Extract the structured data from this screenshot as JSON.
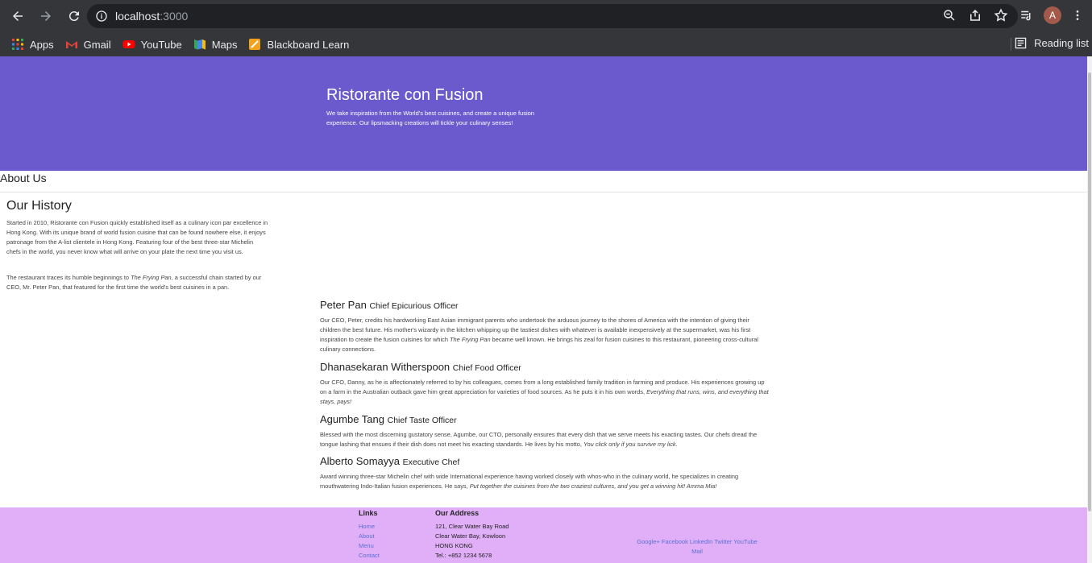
{
  "browser": {
    "url_host": "localhost",
    "url_port": ":3000",
    "avatar_letter": "A",
    "bookmarks": [
      "Apps",
      "Gmail",
      "YouTube",
      "Maps",
      "Blackboard Learn"
    ],
    "reading_list": "Reading list"
  },
  "jumbotron": {
    "title": "Ristorante con Fusion",
    "text": "We take inspiration from the World's best cuisines, and create a unique fusion experience. Our lipsmacking creations will tickle your culinary senses!"
  },
  "breadcrumb": "About Us",
  "history": {
    "title": "Our History",
    "p1": "Started in 2010, Ristorante con Fusion quickly established itself as a culinary icon par excellence in Hong Kong. With its unique brand of world fusion cuisine that can be found nowhere else, it enjoys patronage from the A-list clientele in Hong Kong. Featuring four of the best three-star Michelin chefs in the world, you never know what will arrive on your plate the next time you visit us.",
    "p2_a": "The restaurant traces its humble beginnings to ",
    "p2_em": "The Frying Pan",
    "p2_b": ", a successful chain started by our CEO, Mr. Peter Pan, that featured for the first time the world's best cuisines in a pan."
  },
  "leaders": [
    {
      "name": "Peter Pan",
      "role": "Chief Epicurious Officer",
      "text_a": "Our CEO, Peter, credits his hardworking East Asian immigrant parents who undertook the arduous journey to the shores of America with the intention of giving their children the best future. His mother's wizardy in the kitchen whipping up the tastiest dishes with whatever is available inexpensively at the supermarket, was his first inspiration to create the fusion cuisines for which ",
      "text_em": "The Frying Pan",
      "text_b": " became well known. He brings his zeal for fusion cuisines to this restaurant, pioneering cross-cultural culinary connections."
    },
    {
      "name": "Dhanasekaran Witherspoon",
      "role": "Chief Food Officer",
      "text_a": "Our CFO, Danny, as he is affectionately referred to by his colleagues, comes from a long established family tradition in farming and produce. His experiences growing up on a farm in the Australian outback gave him great appreciation for varieties of food sources. As he puts it in his own words, ",
      "text_em": "Everything that runs, wins, and everything that stays, pays!",
      "text_b": ""
    },
    {
      "name": "Agumbe Tang",
      "role": "Chief Taste Officer",
      "text_a": "Blessed with the most discerning gustatory sense, Agumbe, our CTO, personally ensures that every dish that we serve meets his exacting tastes. Our chefs dread the tongue lashing that ensues if their dish does not meet his exacting standards. He lives by his motto, ",
      "text_em": "You click only if you survive my lick.",
      "text_b": ""
    },
    {
      "name": "Alberto Somayya",
      "role": "Executive Chef",
      "text_a": "Award winning three-star Michelin chef with wide International experience having worked closely with whos-who in the culinary world, he specializes in creating mouthwatering Indo-Italian fusion experiences. He says, ",
      "text_em": "Put together the cuisines from the two craziest cultures, and you get a winning hit! Amma Mia!",
      "text_b": ""
    }
  ],
  "footer": {
    "links_title": "Links",
    "links": [
      "Home",
      "About",
      "Menu",
      "Contact"
    ],
    "address_title": "Our Address",
    "address": [
      "121, Clear Water Bay Road",
      "Clear Water Bay, Kowloon",
      "HONG KONG",
      "Tel.: +852 1234 5678"
    ],
    "social_line1": "Google+ Facebook LinkedIn Twitter YouTube",
    "social_line2": "Mail"
  }
}
